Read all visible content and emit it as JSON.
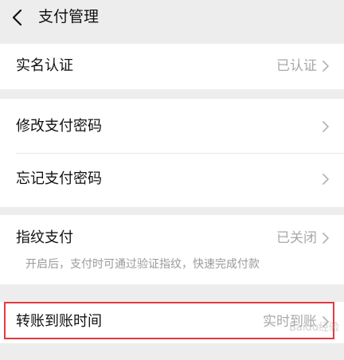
{
  "nav": {
    "title": "支付管理",
    "back_icon": "chevron-left-icon"
  },
  "groups": [
    {
      "rows": [
        {
          "label": "实名认证",
          "value": "已认证"
        }
      ]
    },
    {
      "rows": [
        {
          "label": "修改支付密码",
          "value": ""
        },
        {
          "label": "忘记支付密码",
          "value": ""
        }
      ]
    },
    {
      "rows": [
        {
          "label": "指纹支付",
          "value": "已关闭",
          "description": "开启后，支付时可通过验证指纹，快速完成付款"
        }
      ]
    },
    {
      "rows": [
        {
          "label": "转账到账时间",
          "value": "实时到账"
        }
      ]
    }
  ],
  "colors": {
    "highlight": "#e23a3f",
    "background": "#ededed",
    "row_bg": "#ffffff",
    "secondary_text": "#a8a8a8"
  },
  "watermark": "Baidu经验"
}
